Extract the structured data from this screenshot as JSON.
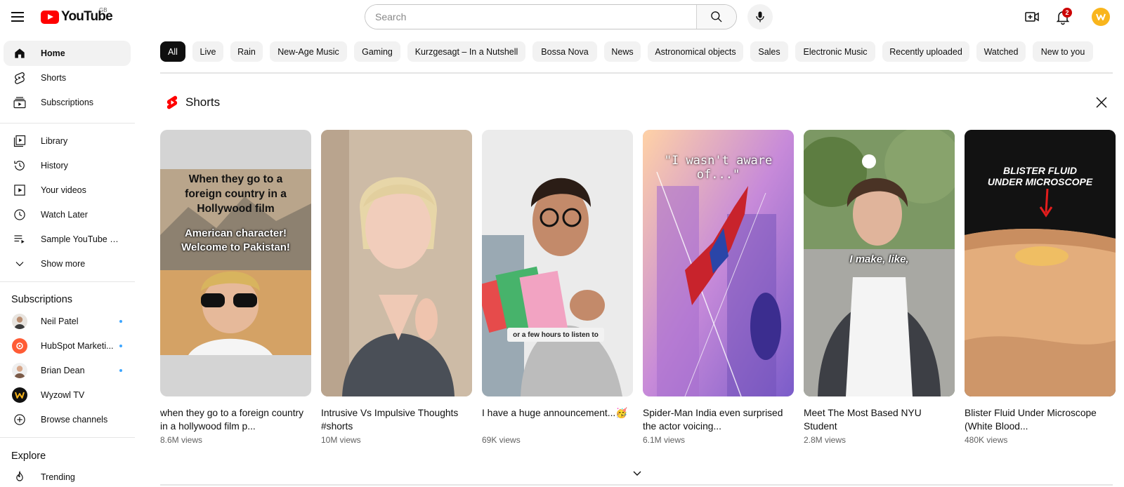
{
  "header": {
    "logo_text": "YouTube",
    "region": "GB",
    "search_placeholder": "Search",
    "notification_count": "2"
  },
  "sidebar": {
    "main": [
      {
        "label": "Home",
        "icon": "home-icon",
        "active": true
      },
      {
        "label": "Shorts",
        "icon": "shorts-icon"
      },
      {
        "label": "Subscriptions",
        "icon": "subscriptions-icon"
      }
    ],
    "library": [
      {
        "label": "Library",
        "icon": "library-icon"
      },
      {
        "label": "History",
        "icon": "history-icon"
      },
      {
        "label": "Your videos",
        "icon": "your-videos-icon"
      },
      {
        "label": "Watch Later",
        "icon": "clock-icon"
      },
      {
        "label": "Sample YouTube Pl...",
        "icon": "playlist-icon"
      },
      {
        "label": "Show more",
        "icon": "chevron-down-icon"
      }
    ],
    "subscriptions_title": "Subscriptions",
    "subscriptions": [
      {
        "label": "Neil Patel"
      },
      {
        "label": "HubSpot Marketi..."
      },
      {
        "label": "Brian Dean"
      },
      {
        "label": "Wyzowl TV"
      }
    ],
    "browse_channels": "Browse channels",
    "explore_title": "Explore",
    "trending": "Trending"
  },
  "chips": [
    "All",
    "Live",
    "Rain",
    "New-Age Music",
    "Gaming",
    "Kurzgesagt – In a Nutshell",
    "Bossa Nova",
    "News",
    "Astronomical objects",
    "Sales",
    "Electronic Music",
    "Recently uploaded",
    "Watched",
    "New to you"
  ],
  "shorts": {
    "title": "Shorts",
    "items": [
      {
        "title": "when they go to a foreign country in a hollywood film p...",
        "views": "8.6M views",
        "overlay1": "When they go to a foreign country in a Hollywood film",
        "overlay2": "American character! Welcome to Pakistan!"
      },
      {
        "title": "Intrusive Vs Impulsive Thoughts #shorts",
        "views": "10M views"
      },
      {
        "title": "I have a huge announcement...🥳",
        "views": "69K views",
        "caption": "or a few hours to listen to"
      },
      {
        "title": "Spider-Man India even surprised the actor voicing...",
        "views": "6.1M views",
        "overlay1": "\"I wasn't aware of...\""
      },
      {
        "title": "Meet The Most Based NYU Student",
        "views": "2.8M views",
        "overlay1": "I make, like,"
      },
      {
        "title": "Blister Fluid Under Microscope (White Blood...",
        "views": "480K views",
        "overlay1": "BLISTER FLUID UNDER MICROSCOPE"
      }
    ]
  },
  "colors": {
    "brand_red": "#ff0000",
    "chip_active": "#0f0f0f",
    "chip_bg": "#f2f2f2",
    "subscription_dot": "#3ea6ff",
    "avatar_yellow": "#f9b51c"
  }
}
